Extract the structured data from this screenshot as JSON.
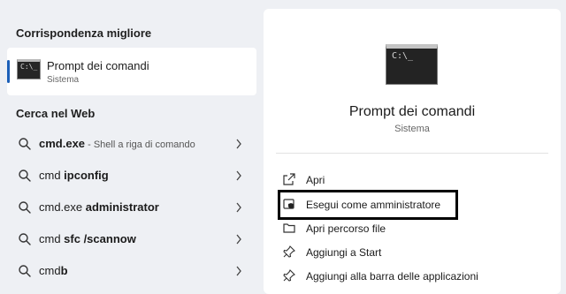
{
  "left": {
    "best_match_title": "Corrispondenza migliore",
    "best_match": {
      "name": "Prompt dei comandi",
      "subtitle": "Sistema",
      "icon": "command-prompt-icon"
    },
    "web_title": "Cerca nel Web",
    "web_results": [
      {
        "bold": "cmd.exe",
        "rest": "",
        "suffix": " - Shell a riga di comando"
      },
      {
        "bold": "cmd ",
        "rest": "ipconfig",
        "suffix": ""
      },
      {
        "bold": "cmd.exe ",
        "rest": "administrator",
        "suffix": ""
      },
      {
        "bold": "cmd ",
        "rest": "sfc /scannow",
        "suffix": ""
      },
      {
        "bold": "cmd",
        "rest": "b",
        "suffix": ""
      }
    ]
  },
  "right": {
    "app_name": "Prompt dei comandi",
    "app_subtitle": "Sistema",
    "icon": "command-prompt-icon",
    "actions": [
      {
        "label": "Apri",
        "icon": "open-icon"
      },
      {
        "label": "Esegui come amministratore",
        "icon": "shield-icon",
        "highlighted": true
      },
      {
        "label": "Apri percorso file",
        "icon": "folder-icon"
      },
      {
        "label": "Aggiungi a Start",
        "icon": "pin-icon"
      },
      {
        "label": "Aggiungi alla barra delle applicazioni",
        "icon": "pin-icon"
      }
    ]
  },
  "colors": {
    "accent": "#1c5fb8",
    "highlight_border": "#000000"
  }
}
